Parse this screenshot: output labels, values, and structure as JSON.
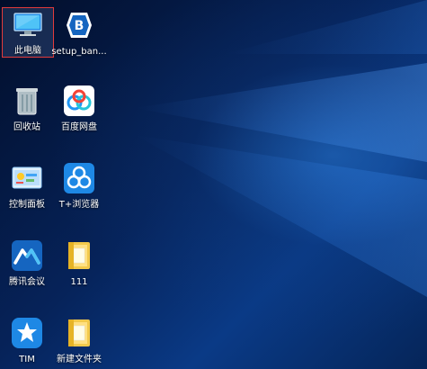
{
  "desktop": {
    "icons": [
      {
        "label": "此电脑",
        "icon": "this-pc-icon",
        "selected": true
      },
      {
        "label": "setup_ban...",
        "icon": "setup-app-icon",
        "selected": false
      },
      {
        "label": "回收站",
        "icon": "recycle-bin-icon",
        "selected": false
      },
      {
        "label": "百度网盘",
        "icon": "baidu-netdisk-icon",
        "selected": false
      },
      {
        "label": "控制面板",
        "icon": "control-panel-icon",
        "selected": false
      },
      {
        "label": "T+浏览器",
        "icon": "t-browser-icon",
        "selected": false
      },
      {
        "label": "腾讯会议",
        "icon": "tencent-meeting-icon",
        "selected": false
      },
      {
        "label": "111",
        "icon": "folder-icon",
        "selected": false
      },
      {
        "label": "TIM",
        "icon": "tim-icon",
        "selected": false
      },
      {
        "label": "新建文件夹",
        "icon": "folder-icon",
        "selected": false
      }
    ]
  },
  "colors": {
    "selection_border": "#e23b3b",
    "wallpaper_dark": "#020e2a",
    "wallpaper_light": "#0a3a86"
  }
}
